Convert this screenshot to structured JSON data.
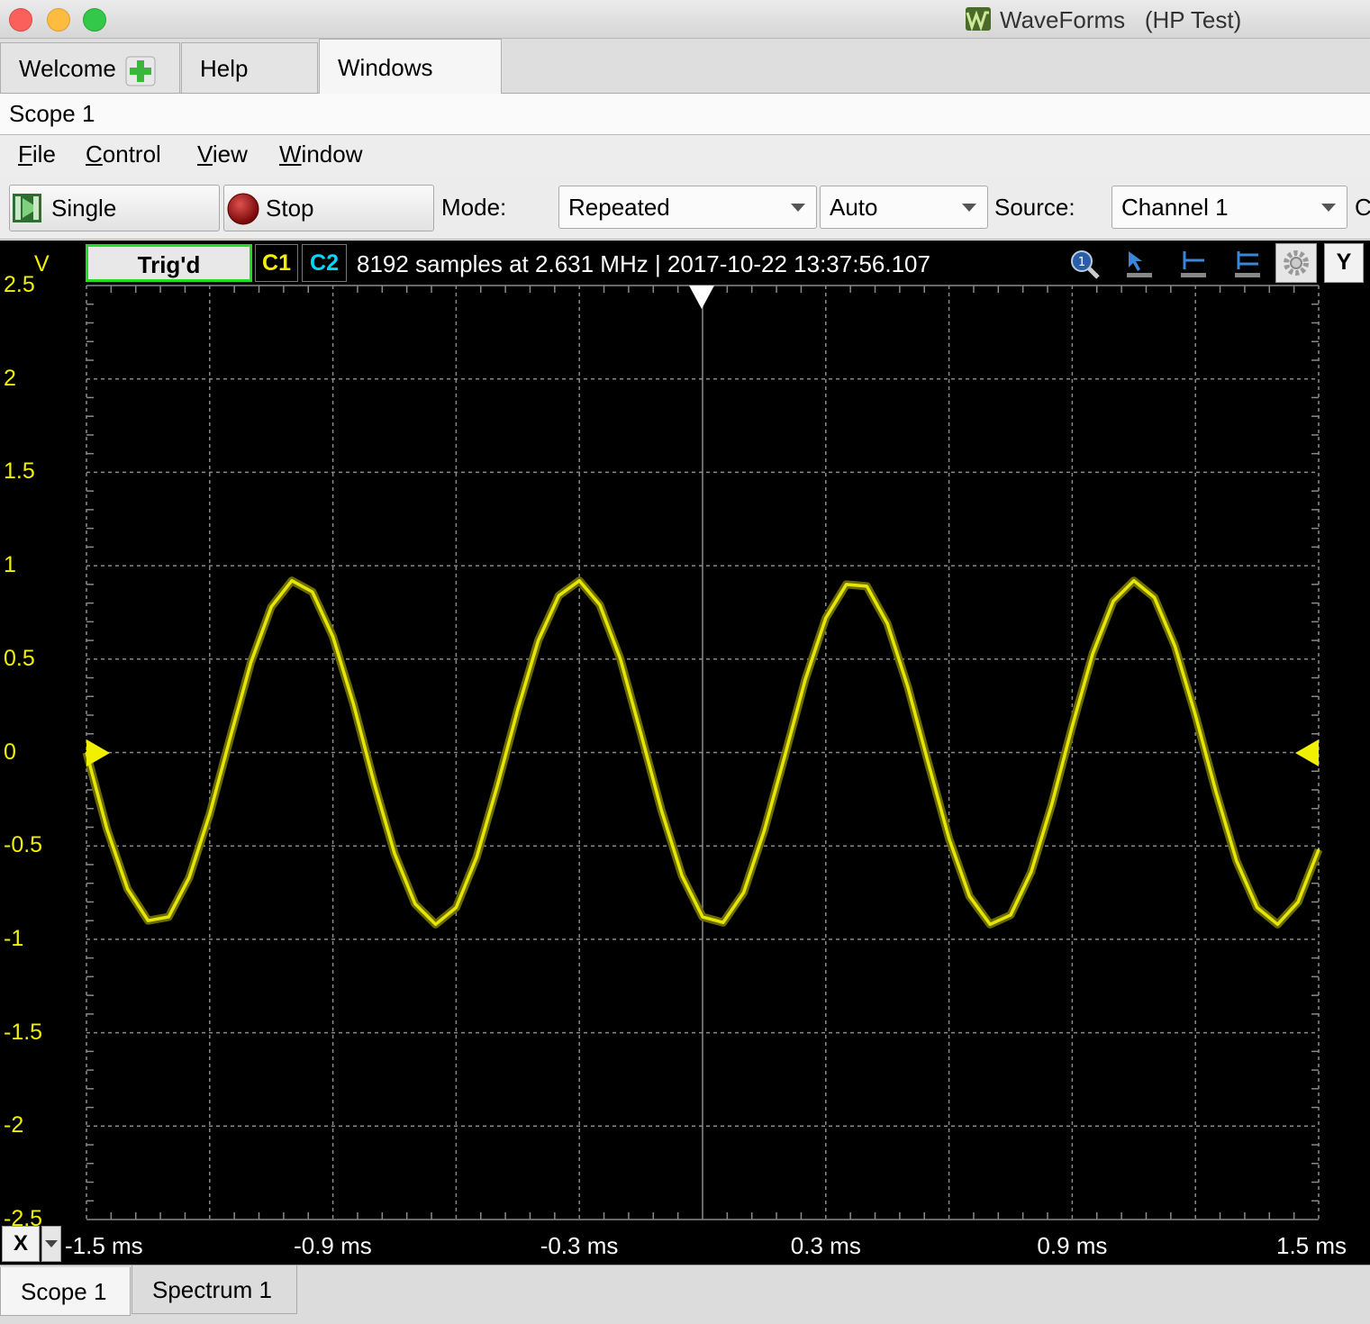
{
  "window": {
    "title": "WaveForms   (HP Test)"
  },
  "tabs": [
    {
      "label": "Welcome"
    },
    {
      "label": "Help"
    },
    {
      "label": "Windows"
    }
  ],
  "scope_title": "Scope 1",
  "menu": {
    "file": {
      "u": "F",
      "rest": "ile"
    },
    "control": {
      "u": "C",
      "rest": "ontrol"
    },
    "view": {
      "u": "V",
      "rest": "iew"
    },
    "window": {
      "u": "W",
      "rest": "indow"
    }
  },
  "toolbar": {
    "single_label": "Single",
    "stop_label": "Stop",
    "mode_label": "Mode:",
    "mode_value": "Repeated",
    "auto_value": "Auto",
    "source_label": "Source:",
    "source_value": "Channel 1",
    "cut_label": "C"
  },
  "plot": {
    "y_unit": "V",
    "trig_status": "Trig'd",
    "c1_label": "C1",
    "c2_label": "C2",
    "info": "8192 samples at 2.631 MHz | 2017-10-22 13:37:56.107",
    "y_button": "Y",
    "x_button": "X"
  },
  "bottom_tabs": [
    {
      "label": "Scope 1"
    },
    {
      "label": "Spectrum 1"
    }
  ],
  "colors": {
    "trace_c1": "#e6e600",
    "c2": "#00d8ff",
    "trig_border": "#22dd22"
  },
  "chart_data": {
    "type": "line",
    "title": "",
    "xlabel": "",
    "ylabel": "V",
    "xlim": [
      -1.5,
      1.5
    ],
    "ylim": [
      -2.5,
      2.5
    ],
    "x_unit": "ms",
    "grid": true,
    "y_ticks": [
      "2.5",
      "2",
      "1.5",
      "1",
      "0.5",
      "0",
      "-0.5",
      "-1",
      "-1.5",
      "-2",
      "-2.5"
    ],
    "x_ticks": [
      "-1.5 ms",
      "-0.9 ms",
      "-0.3 ms",
      "0.3 ms",
      "0.9 ms",
      "1.5 ms"
    ],
    "series": [
      {
        "color": "#e6e600",
        "x": [
          -1.5,
          -1.45,
          -1.4,
          -1.35,
          -1.3,
          -1.25,
          -1.2,
          -1.15,
          -1.1,
          -1.05,
          -1.0,
          -0.95,
          -0.9,
          -0.85,
          -0.8,
          -0.75,
          -0.7,
          -0.65,
          -0.6,
          -0.55,
          -0.5,
          -0.45,
          -0.4,
          -0.35,
          -0.3,
          -0.25,
          -0.2,
          -0.15,
          -0.1,
          -0.05,
          0.0,
          0.05,
          0.1,
          0.15,
          0.2,
          0.25,
          0.3,
          0.35,
          0.4,
          0.45,
          0.5,
          0.55,
          0.6,
          0.65,
          0.7,
          0.75,
          0.8,
          0.85,
          0.9,
          0.95,
          1.0,
          1.05,
          1.1,
          1.15,
          1.2,
          1.25,
          1.3,
          1.35,
          1.4,
          1.45,
          1.5
        ],
        "y": [
          0.0,
          -0.41,
          -0.73,
          -0.9,
          -0.88,
          -0.67,
          -0.33,
          0.08,
          0.48,
          0.78,
          0.92,
          0.86,
          0.62,
          0.26,
          -0.16,
          -0.54,
          -0.81,
          -0.92,
          -0.83,
          -0.56,
          -0.18,
          0.23,
          0.6,
          0.84,
          0.92,
          0.79,
          0.5,
          0.1,
          -0.31,
          -0.66,
          -0.88,
          -0.91,
          -0.75,
          -0.42,
          -0.02,
          0.39,
          0.72,
          0.9,
          0.89,
          0.69,
          0.35,
          -0.06,
          -0.46,
          -0.77,
          -0.92,
          -0.87,
          -0.64,
          -0.28,
          0.14,
          0.53,
          0.81,
          0.92,
          0.83,
          0.57,
          0.2,
          -0.21,
          -0.58,
          -0.83,
          -0.92,
          -0.8,
          -0.52
        ]
      }
    ]
  }
}
